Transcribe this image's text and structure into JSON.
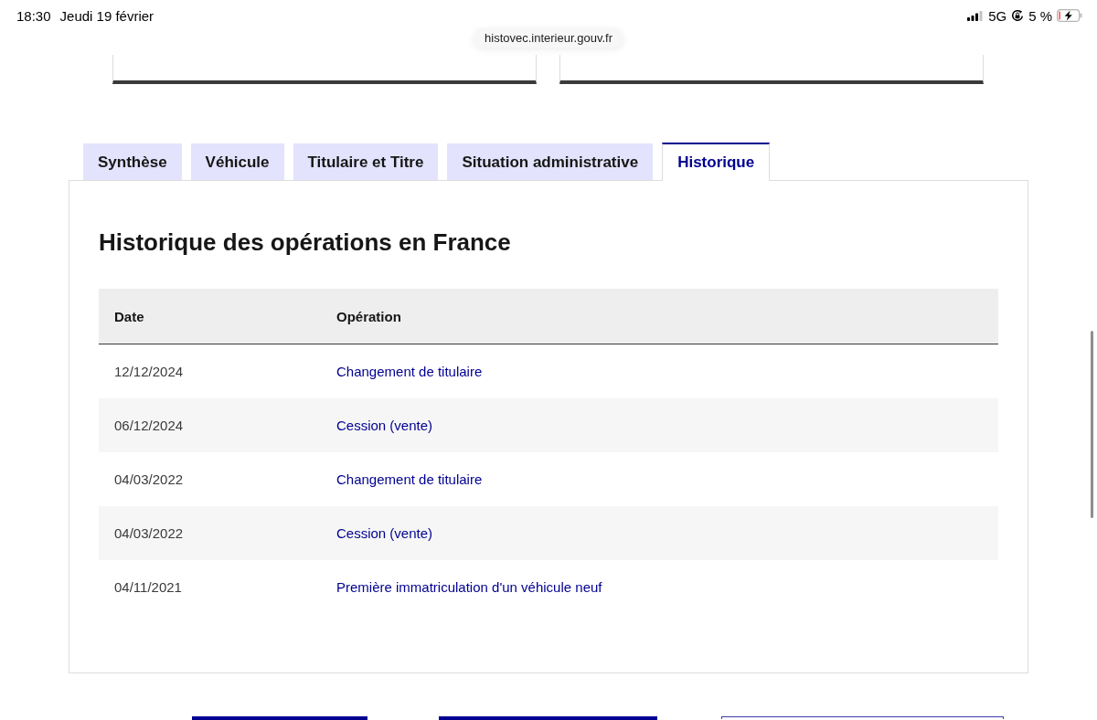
{
  "status_bar": {
    "time": "18:30",
    "date": "Jeudi 19 février",
    "network": "5G",
    "battery": "5 %"
  },
  "url_bar": {
    "url": "histovec.interieur.gouv.fr"
  },
  "tabs": [
    {
      "label": "Synthèse",
      "selected": false
    },
    {
      "label": "Véhicule",
      "selected": false
    },
    {
      "label": "Titulaire et Titre",
      "selected": false
    },
    {
      "label": "Situation administrative",
      "selected": false
    },
    {
      "label": "Historique",
      "selected": true
    }
  ],
  "panel": {
    "title": "Historique des opérations en France",
    "table": {
      "columns": [
        "Date",
        "Opération"
      ],
      "rows": [
        {
          "date": "12/12/2024",
          "operation": "Changement de titulaire"
        },
        {
          "date": "06/12/2024",
          "operation": "Cession (vente)"
        },
        {
          "date": "04/03/2022",
          "operation": "Changement de titulaire"
        },
        {
          "date": "04/03/2022",
          "operation": "Cession (vente)"
        },
        {
          "date": "04/11/2021",
          "operation": "Première immatriculation d'un véhicule neuf"
        }
      ]
    }
  }
}
